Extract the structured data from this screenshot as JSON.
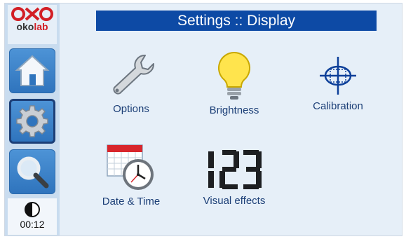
{
  "brand": {
    "logo_icon": "okolab-logo-icon",
    "name_prefix": "oko",
    "name_suffix": "lab"
  },
  "nav": [
    {
      "id": "home",
      "icon": "home-icon"
    },
    {
      "id": "settings",
      "icon": "gear-icon",
      "active": true
    },
    {
      "id": "search",
      "icon": "search-icon"
    }
  ],
  "status": {
    "icon": "contrast-icon",
    "timer": "00:12"
  },
  "header": {
    "title": "Settings :: Display"
  },
  "tiles": [
    {
      "id": "options",
      "label": "Options",
      "icon": "wrench-icon"
    },
    {
      "id": "brightness",
      "label": "Brightness",
      "icon": "lightbulb-icon"
    },
    {
      "id": "calibration",
      "label": "Calibration",
      "icon": "crosshair-icon"
    },
    {
      "id": "date-time",
      "label": "Date & Time",
      "icon": "calendar-clock-icon"
    },
    {
      "id": "visual-effects",
      "label": "Visual effects",
      "icon": "digits-123-icon"
    }
  ],
  "colors": {
    "title_bg": "#0d4aa5",
    "label": "#1c3f77",
    "screen_bg": "#e6eff8",
    "logo_red": "#d21f26"
  }
}
